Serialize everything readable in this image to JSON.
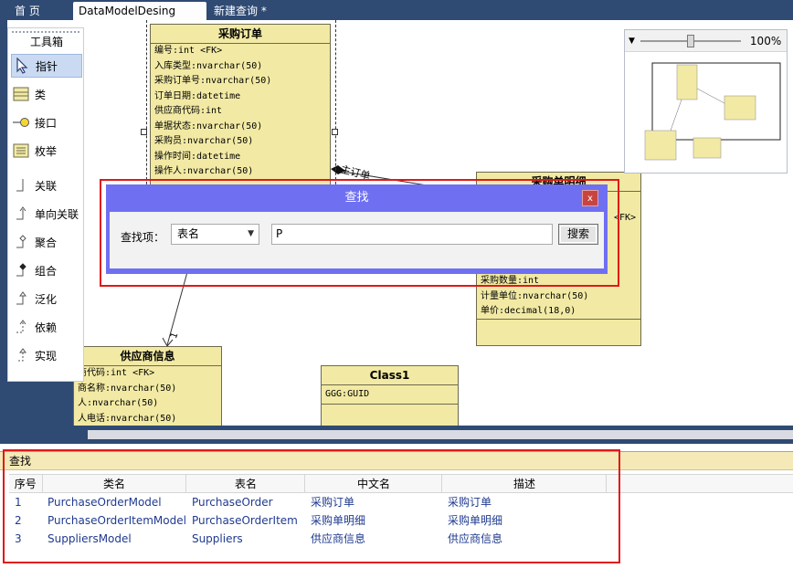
{
  "tabs": [
    {
      "label": "首 页",
      "active": false
    },
    {
      "label": "DataModelDesing *",
      "active": true
    },
    {
      "label": "新建查询 *",
      "active": false
    }
  ],
  "tab_close_glyph": "✕",
  "toolbox": {
    "title": "工具箱",
    "items": [
      {
        "label": "指针",
        "icon": "pointer-icon",
        "active": true
      },
      {
        "label": "类",
        "icon": "class-icon"
      },
      {
        "label": "接口",
        "icon": "interface-icon"
      },
      {
        "label": "枚举",
        "icon": "enum-icon"
      },
      {
        "label": "关联",
        "icon": "association-icon"
      },
      {
        "label": "单向关联",
        "icon": "directed-association-icon"
      },
      {
        "label": "聚合",
        "icon": "aggregation-icon"
      },
      {
        "label": "组合",
        "icon": "composition-icon"
      },
      {
        "label": "泛化",
        "icon": "generalization-icon"
      },
      {
        "label": "依赖",
        "icon": "dependency-icon"
      },
      {
        "label": "实现",
        "icon": "realization-icon"
      }
    ]
  },
  "entities": {
    "purchase_order": {
      "title": "采购订单",
      "rows": [
        "编号:int <FK>",
        "入库类型:nvarchar(50)",
        "采购订单号:nvarchar(50)",
        "订单日期:datetime",
        "供应商代码:int",
        "单据状态:nvarchar(50)",
        "采购员:nvarchar(50)",
        "操作时间:datetime",
        "操作人:nvarchar(50)"
      ]
    },
    "order_item": {
      "title": "采购单明细",
      "fk_fragment": "<FK>",
      "rows": [
        "采购数量:int",
        "计量单位:nvarchar(50)",
        "单价:decimal(18,0)"
      ]
    },
    "supplier": {
      "title": "供应商信息",
      "rows": [
        "商代码:int <FK>",
        "商名称:nvarchar(50)",
        "人:nvarchar(50)",
        "人电话:nvarchar(50)"
      ]
    },
    "class1": {
      "title": "Class1",
      "rows": [
        "GGG:GUID"
      ]
    }
  },
  "relations": {
    "main_order_label": "主订单",
    "multiplicity_1": "1"
  },
  "overview": {
    "zoom": "100%",
    "zoom_level_fraction": 0.5,
    "dropdown_glyph": "▼"
  },
  "find_dialog": {
    "title": "查找",
    "close_glyph": "x",
    "field_label": "查找项：",
    "field_value": "表名",
    "caret_glyph": "▼",
    "query": "P",
    "search_button": "搜索"
  },
  "results": {
    "title": "查找",
    "columns": [
      "序号",
      "类名",
      "表名",
      "中文名",
      "描述"
    ],
    "rows": [
      [
        "1",
        "PurchaseOrderModel",
        "PurchaseOrder",
        "采购订单",
        "采购订单"
      ],
      [
        "2",
        "PurchaseOrderItemModel",
        "PurchaseOrderItem",
        "采购单明细",
        "采购单明细"
      ],
      [
        "3",
        "SuppliersModel",
        "Suppliers",
        "供应商信息",
        "供应商信息"
      ]
    ]
  },
  "colors": {
    "dark_chrome": "#2f4a73",
    "entity_fill": "#f2eaa4",
    "dialog_frame": "#6f70f1",
    "highlight_box": "#e01818",
    "results_header": "#f5e9b8",
    "result_text": "#1f3a8f"
  }
}
